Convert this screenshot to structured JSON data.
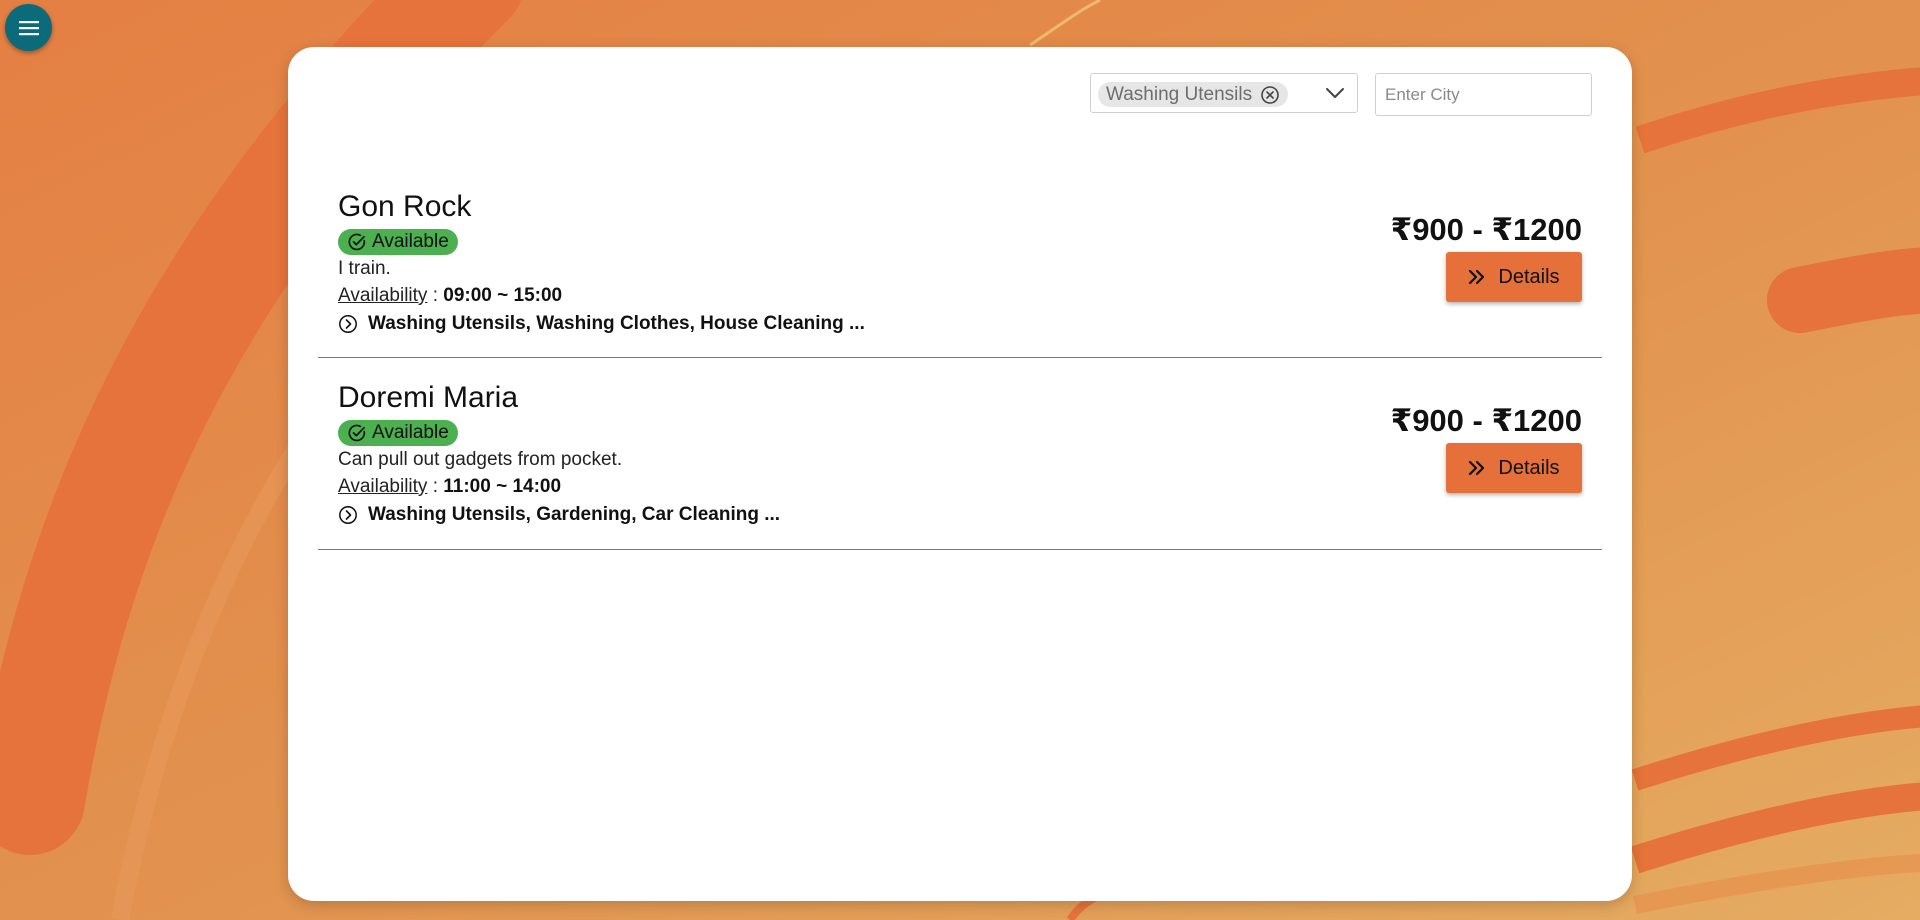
{
  "menu": {
    "icon": "hamburger-menu-icon"
  },
  "filters": {
    "selected_service": "Washing Utensils",
    "city_placeholder": "Enter City",
    "city_value": ""
  },
  "listings": [
    {
      "name": "Gon Rock",
      "status": "Available",
      "description": "I train.",
      "availability_label": "Availability",
      "availability_sep": " : ",
      "availability_time": "09:00 ~ 15:00",
      "services": "Washing Utensils, Washing Clothes, House Cleaning ...",
      "price": "₹900 - ₹1200",
      "details_label": "Details"
    },
    {
      "name": "Doremi Maria",
      "status": "Available",
      "description": "Can pull out gadgets from pocket.",
      "availability_label": "Availability",
      "availability_sep": " : ",
      "availability_time": "11:00 ~ 14:00",
      "services": "Washing Utensils, Gardening, Car Cleaning ...",
      "price": "₹900 - ₹1200",
      "details_label": "Details"
    }
  ],
  "colors": {
    "background": "#e2904f",
    "menu_button": "#0b6b7b",
    "status_badge": "#4caf50",
    "details_button": "#e5703a",
    "card": "#ffffff"
  }
}
